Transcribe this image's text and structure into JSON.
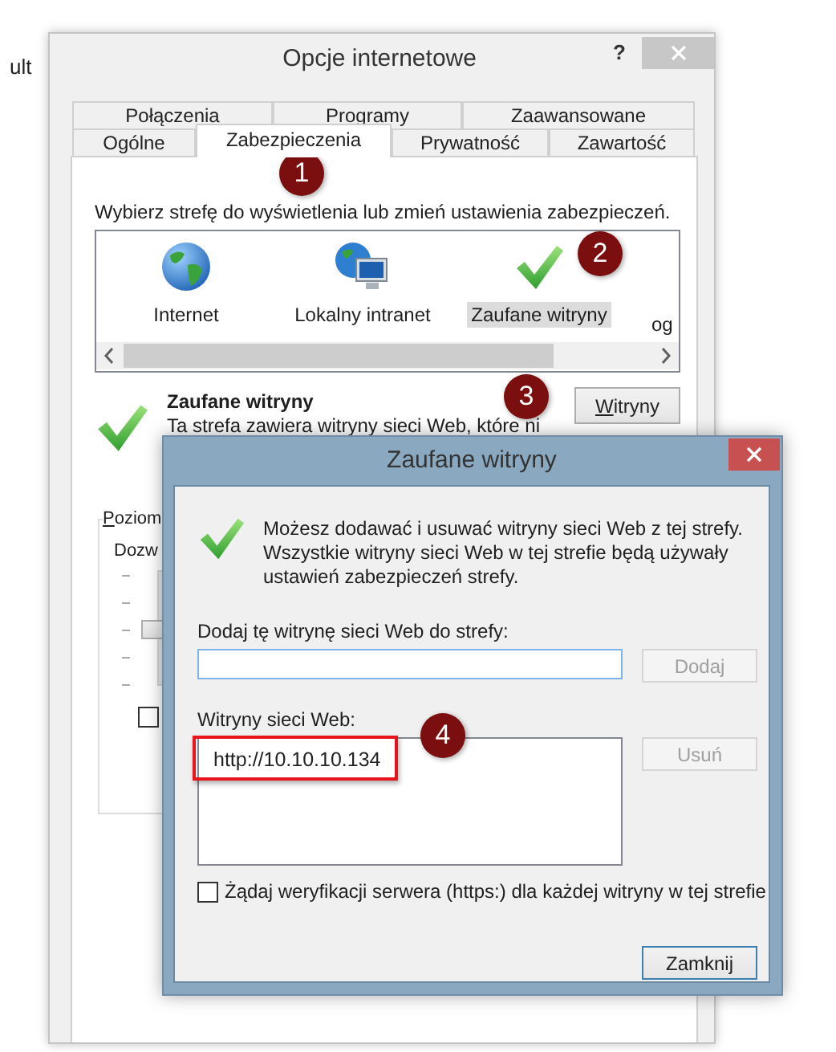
{
  "background": {
    "text": "ult"
  },
  "window": {
    "title": "Opcje internetowe",
    "help": "?"
  },
  "tab_rows": [
    [
      {
        "label": "Połączenia",
        "selected": false
      },
      {
        "label": "Programy",
        "selected": false
      },
      {
        "label": "Zaawansowane",
        "selected": false
      }
    ],
    [
      {
        "label": "Ogólne",
        "selected": false
      },
      {
        "label": "Zabezpieczenia",
        "selected": true
      },
      {
        "label": "Prywatność",
        "selected": false
      },
      {
        "label": "Zawartość",
        "selected": false
      }
    ]
  ],
  "security_tab": {
    "instruction": "Wybierz strefę do wyświetlenia lub zmień ustawienia zabezpieczeń.",
    "zones": [
      {
        "label": "Internet",
        "kind": "globe",
        "selected": false
      },
      {
        "label": "Lokalny intranet",
        "kind": "intranet",
        "selected": false
      },
      {
        "label": "Zaufane witryny",
        "kind": "check",
        "selected": true
      },
      {
        "label": "og",
        "kind": "cut",
        "selected": false
      }
    ],
    "zone_title": "Zaufane witryny",
    "zone_description": [
      "Ta strefa zawiera witryny sieci Web, które ni"
    ],
    "sites_button": "Witryny",
    "level_group": "Poziom",
    "level_caption": "Dozw",
    "slider": {
      "level": 0.5
    },
    "checkbox": {
      "checked": false
    }
  },
  "dialog": {
    "title": "Zaufane witryny",
    "info": [
      "Możesz dodawać i usuwać witryny sieci Web z tej strefy.",
      "Wszystkie witryny sieci Web w tej strefie będą używały",
      "ustawień zabezpieczeń strefy."
    ],
    "add_label": "Dodaj tę witrynę sieci Web do strefy:",
    "add_button": {
      "label": "Dodaj",
      "disabled": true,
      "default": false
    },
    "list_label": "Witryny sieci Web:",
    "sites": [
      {
        "text": "http://10.10.10.134",
        "selected": false,
        "highlighted": true
      }
    ],
    "remove_button": {
      "label": "Usuń",
      "disabled": true,
      "default": false
    },
    "https_checkbox": {
      "label": "Żądaj weryfikacji serwera (https:) dla każdej witryny w tej strefie",
      "checked": false
    },
    "close_button": {
      "label": "Zamknij",
      "disabled": false,
      "default": true
    }
  },
  "annotations": [
    {
      "number": "1"
    },
    {
      "number": "2"
    },
    {
      "number": "3"
    },
    {
      "number": "4"
    }
  ]
}
